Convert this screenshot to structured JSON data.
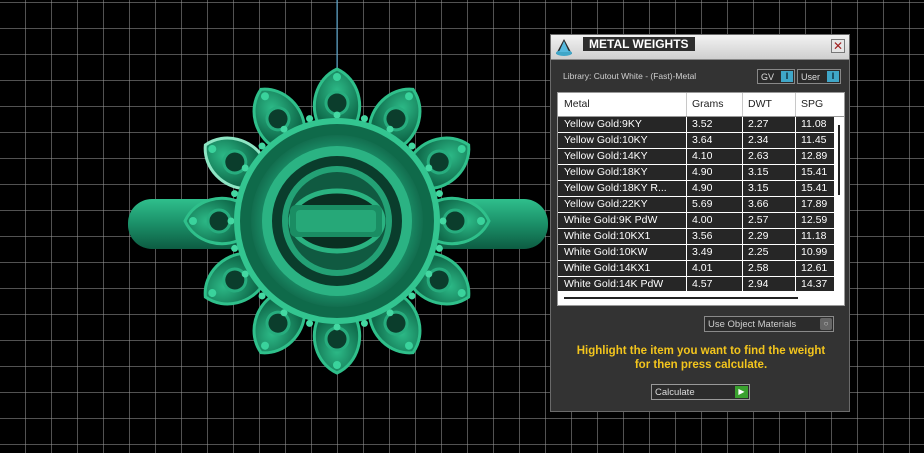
{
  "panel": {
    "title": "METAL WEIGHTS",
    "close_glyph": "✕",
    "library_label": "Library: Cutout White - (Fast)-Metal",
    "gv_label": "GV",
    "user_label": "User",
    "toggle_glyph": "I",
    "columns": [
      "Metal",
      "Grams",
      "DWT",
      "SPG"
    ],
    "rows": [
      {
        "metal": "Yellow Gold:9KY",
        "grams": "3.52",
        "dwt": "2.27",
        "spg": "11.08"
      },
      {
        "metal": "Yellow Gold:10KY",
        "grams": "3.64",
        "dwt": "2.34",
        "spg": "11.45"
      },
      {
        "metal": "Yellow Gold:14KY",
        "grams": "4.10",
        "dwt": "2.63",
        "spg": "12.89"
      },
      {
        "metal": "Yellow Gold:18KY",
        "grams": "4.90",
        "dwt": "3.15",
        "spg": "15.41"
      },
      {
        "metal": "Yellow Gold:18KY R...",
        "grams": "4.90",
        "dwt": "3.15",
        "spg": "15.41"
      },
      {
        "metal": "Yellow Gold:22KY",
        "grams": "5.69",
        "dwt": "3.66",
        "spg": "17.89"
      },
      {
        "metal": "White Gold:9K PdW",
        "grams": "4.00",
        "dwt": "2.57",
        "spg": "12.59"
      },
      {
        "metal": "White Gold:10KX1",
        "grams": "3.56",
        "dwt": "2.29",
        "spg": "11.18"
      },
      {
        "metal": "White Gold:10KW",
        "grams": "3.49",
        "dwt": "2.25",
        "spg": "10.99"
      },
      {
        "metal": "White Gold:14KX1",
        "grams": "4.01",
        "dwt": "2.58",
        "spg": "12.61"
      },
      {
        "metal": "White Gold:14K PdW",
        "grams": "4.57",
        "dwt": "2.94",
        "spg": "14.37"
      }
    ],
    "use_materials_label": "Use Object Materials",
    "instruction_line1": "Highlight the item you want to find the weight",
    "instruction_line2": "for then press calculate.",
    "calculate_label": "Calculate",
    "play_glyph": "▶"
  },
  "colors": {
    "viewport_bg": "#000000",
    "ring": "#1fa077",
    "instruction": "#f3c51d",
    "toggle_accent": "#3fa6c8",
    "calculate_accent": "#3aa12f"
  },
  "icons": {
    "app": "triangle-hat-icon",
    "close": "close-icon",
    "play": "play-icon",
    "dropdown": "dropdown-knob-icon"
  }
}
